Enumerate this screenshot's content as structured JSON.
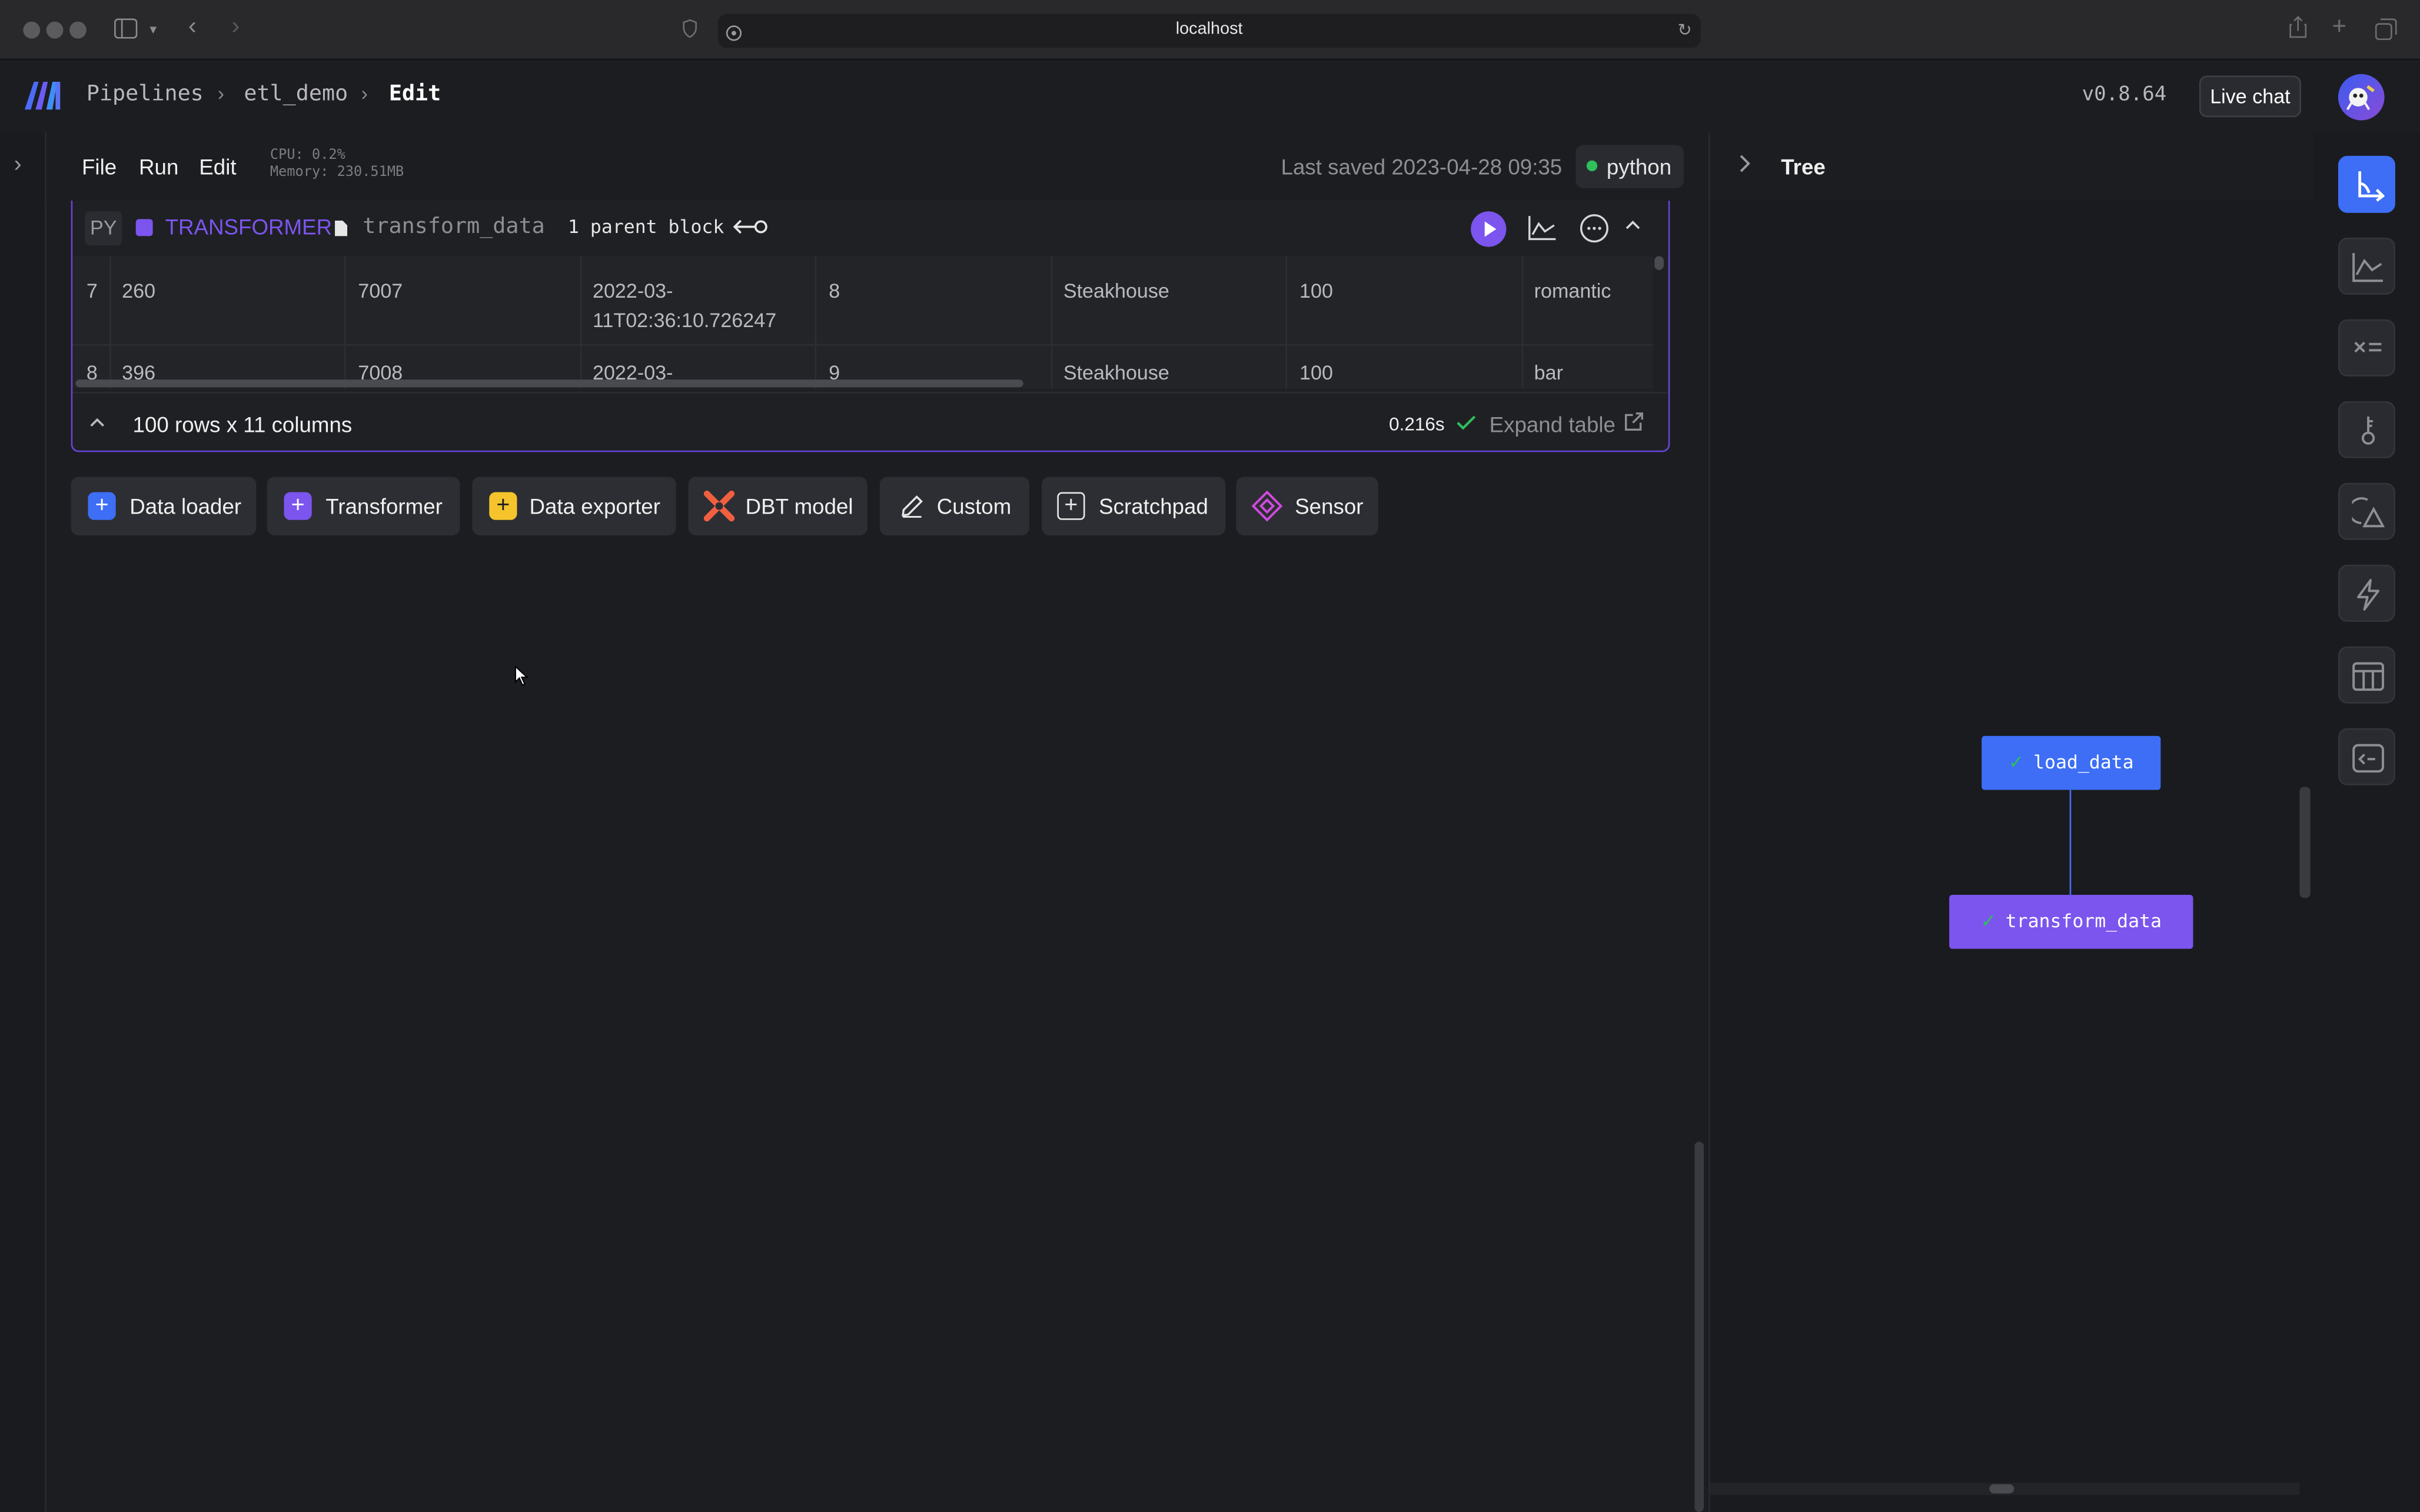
{
  "browser": {
    "url": "localhost"
  },
  "header": {
    "breadcrumbs": [
      "Pipelines",
      "etl_demo",
      "Edit"
    ],
    "version": "v0.8.64",
    "live_chat": "Live chat"
  },
  "toolbar": {
    "menu": [
      "File",
      "Run",
      "Edit"
    ],
    "cpu": "CPU: 0.2%",
    "memory": "Memory: 230.51MB",
    "last_saved": "Last saved 2023-04-28 09:35",
    "kernel": "python"
  },
  "block": {
    "language": "PY",
    "type": "TRANSFORMER",
    "name": "transform_data",
    "parents": "1 parent block",
    "rows": [
      {
        "index": "7",
        "cells": [
          "260",
          "7007",
          "2022-03-",
          "8",
          "Steakhouse",
          "100",
          "romantic"
        ],
        "cells_line2": [
          "",
          "",
          "11T02:36:10.726247",
          "",
          "",
          "",
          ""
        ]
      },
      {
        "index": "8",
        "cells": [
          "396",
          "7008",
          "2022-03-",
          "9",
          "Steakhouse",
          "100",
          "bar"
        ],
        "cells_line2": [
          "",
          "",
          "",
          "",
          "",
          "",
          ""
        ]
      }
    ],
    "summary": "100 rows x 11 columns",
    "duration": "0.216s",
    "expand": "Expand table"
  },
  "add_blocks": [
    "Data loader",
    "Transformer",
    "Data exporter",
    "DBT model",
    "Custom",
    "Scratchpad",
    "Sensor"
  ],
  "colors": {
    "accent_purple": "#7b55ee",
    "loader_blue": "#3d6ef5",
    "exporter_yellow": "#f5c32c",
    "dbt_orange": "#f06040",
    "status_green": "#2fbf5b"
  },
  "tree": {
    "title": "Tree",
    "nodes": [
      "load_data",
      "transform_data"
    ]
  }
}
